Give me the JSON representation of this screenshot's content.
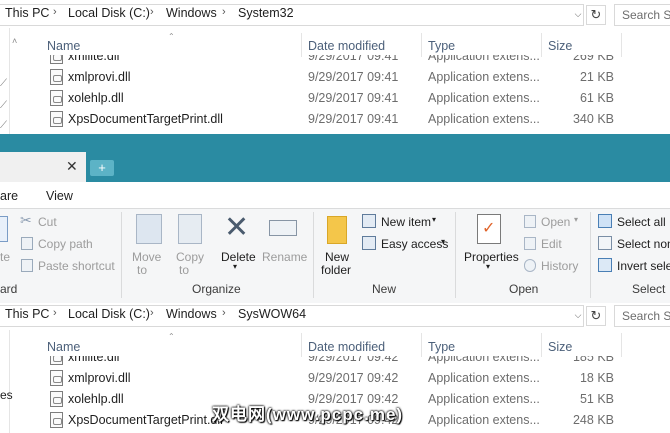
{
  "top_window": {
    "breadcrumb": [
      "This PC",
      "Local Disk (C:)",
      "Windows",
      "System32"
    ],
    "search_placeholder": "Search Sy",
    "columns": {
      "name": "Name",
      "date": "Date modified",
      "type": "Type",
      "size": "Size"
    },
    "rows": [
      {
        "name": "xmllite.dll",
        "date": "9/29/2017 09:41",
        "type": "Application extens...",
        "size": "269 KB"
      },
      {
        "name": "xmlprovi.dll",
        "date": "9/29/2017 09:41",
        "type": "Application extens...",
        "size": "21 KB"
      },
      {
        "name": "xolehlp.dll",
        "date": "9/29/2017 09:41",
        "type": "Application extens...",
        "size": "61 KB"
      },
      {
        "name": "XpsDocumentTargetPrint.dll",
        "date": "9/29/2017 09:41",
        "type": "Application extens...",
        "size": "340 KB"
      }
    ]
  },
  "tabbar": {
    "close_glyph": "✕",
    "new_tab_glyph": "+"
  },
  "menu": {
    "share": "are",
    "view": "View"
  },
  "ribbon": {
    "clipboard": {
      "cut": "Cut",
      "copy_path": "Copy path",
      "paste_shortcut": "Paste shortcut",
      "paste_fragment": "te",
      "group_fragment": "ard"
    },
    "organize": {
      "move_to_1": "Move",
      "move_to_2": "to",
      "copy_to_1": "Copy",
      "copy_to_2": "to",
      "delete": "Delete",
      "rename": "Rename",
      "group": "Organize"
    },
    "new": {
      "new_item": "New item",
      "easy_access": "Easy access",
      "new_folder_1": "New",
      "new_folder_2": "folder",
      "group": "New"
    },
    "open": {
      "properties": "Properties",
      "open": "Open",
      "edit": "Edit",
      "history": "History",
      "group": "Open"
    },
    "select": {
      "select_all": "Select all",
      "select_none": "Select non",
      "invert": "Invert sele",
      "group": "Select"
    }
  },
  "bottom_window": {
    "breadcrumb": [
      "This PC",
      "Local Disk (C:)",
      "Windows",
      "SysWOW64"
    ],
    "search_placeholder": "Search Sy",
    "nav_fragment": "es",
    "columns": {
      "name": "Name",
      "date": "Date modified",
      "type": "Type",
      "size": "Size"
    },
    "rows": [
      {
        "name": "xmllite.dll",
        "date": "9/29/2017 09:42",
        "type": "Application extens...",
        "size": "185 KB"
      },
      {
        "name": "xmlprovi.dll",
        "date": "9/29/2017 09:42",
        "type": "Application extens...",
        "size": "18 KB"
      },
      {
        "name": "xolehlp.dll",
        "date": "9/29/2017 09:42",
        "type": "Application extens...",
        "size": "51 KB"
      },
      {
        "name": "XpsDocumentTargetPrint.dll",
        "date": "9/29/2017 09:42",
        "type": "Application extens...",
        "size": "248 KB"
      }
    ]
  },
  "watermark": "双电网(www.pcpc.me)",
  "colors": {
    "titlebar": "#2a8ba2",
    "column_header": "#4c607a",
    "ribbon_bg": "#f5f6f7"
  }
}
